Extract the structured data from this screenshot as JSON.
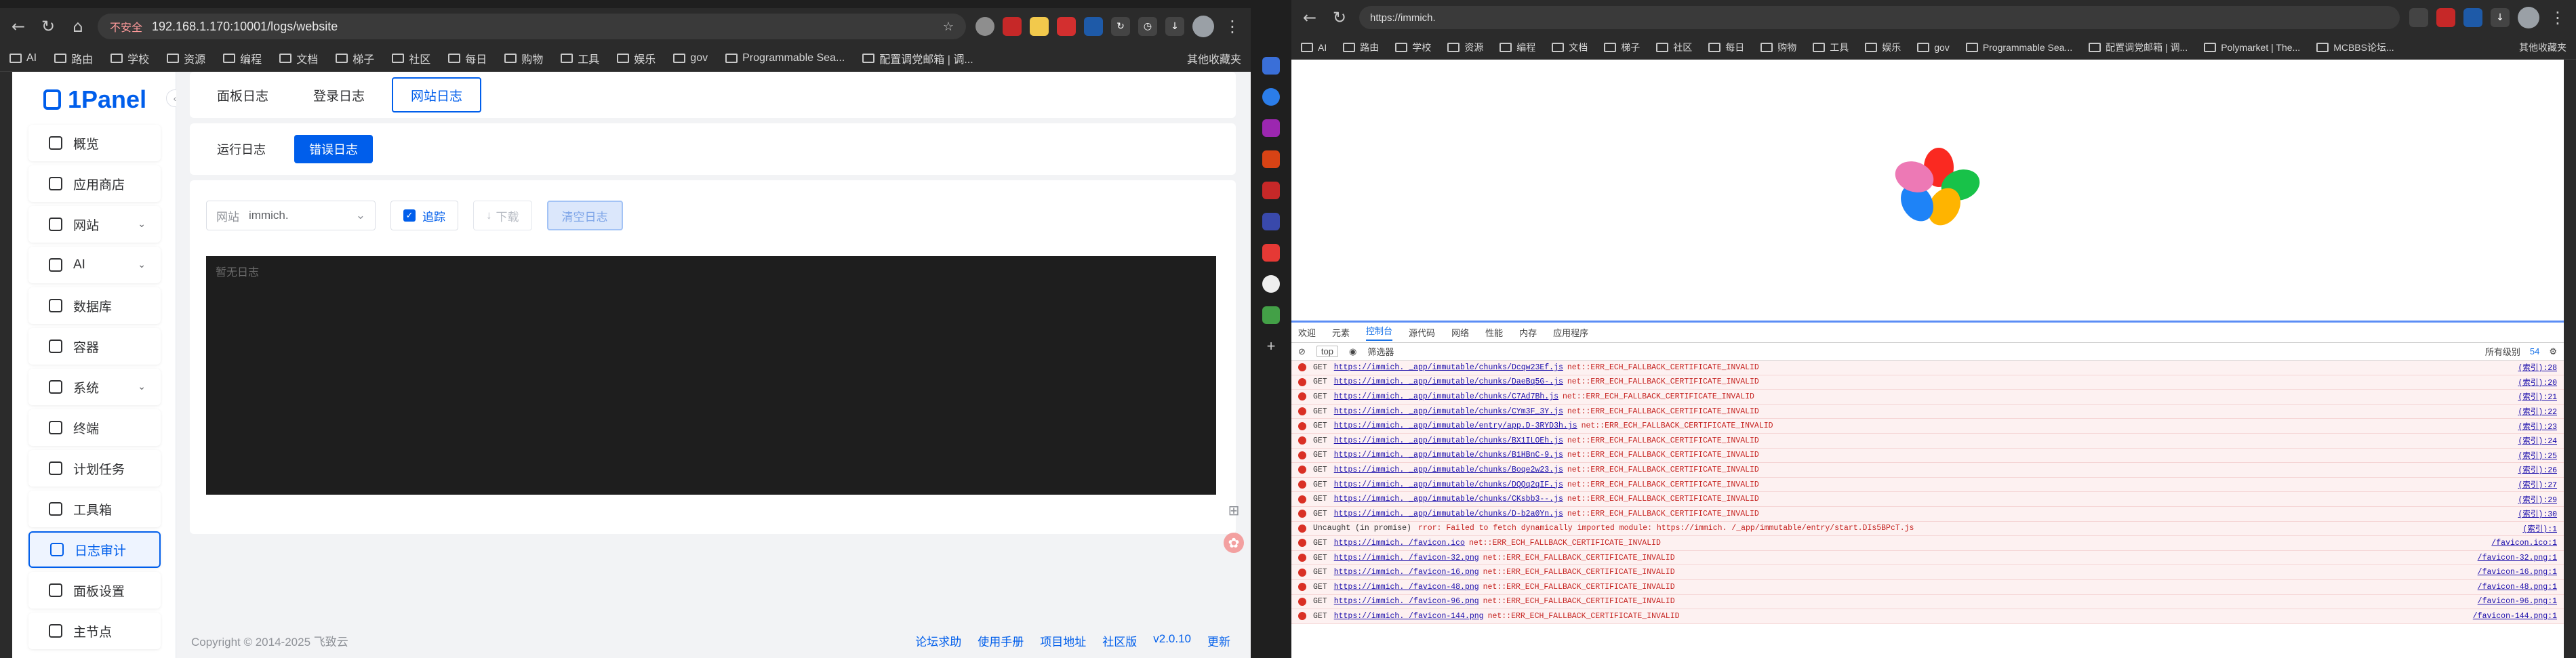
{
  "left_browser": {
    "url": "192.168.1.170:10001/logs/website",
    "security_label": "不安全",
    "bookmarks": [
      "AI",
      "路由",
      "学校",
      "资源",
      "编程",
      "文档",
      "梯子",
      "社区",
      "每日",
      "购物",
      "工具",
      "娱乐",
      "gov",
      "Programmable Sea...",
      "配置调党邮箱 | 调..."
    ],
    "bookmarks_other": "其他收藏夹"
  },
  "app": {
    "logo": "1Panel",
    "menu": [
      {
        "label": "概览",
        "chevron": false
      },
      {
        "label": "应用商店",
        "chevron": false
      },
      {
        "label": "网站",
        "chevron": true
      },
      {
        "label": "AI",
        "chevron": true
      },
      {
        "label": "数据库",
        "chevron": false
      },
      {
        "label": "容器",
        "chevron": false
      },
      {
        "label": "系统",
        "chevron": true
      },
      {
        "label": "终端",
        "chevron": false
      },
      {
        "label": "计划任务",
        "chevron": false
      },
      {
        "label": "工具箱",
        "chevron": false
      },
      {
        "label": "日志审计",
        "chevron": false,
        "active": true
      },
      {
        "label": "面板设置",
        "chevron": false
      },
      {
        "label": "主节点",
        "chevron": false
      }
    ],
    "tabs": [
      "面板日志",
      "登录日志",
      "网站日志"
    ],
    "active_tab": "网站日志",
    "subtabs": [
      "运行日志",
      "错误日志"
    ],
    "active_subtab": "错误日志",
    "site_select": {
      "prefix": "网站",
      "value": "immich."
    },
    "follow_label": "追踪",
    "download_label": "下载",
    "clear_label": "清空日志",
    "empty_log": "暂无日志",
    "footer_copyright": "Copyright © 2014-2025 飞致云",
    "footer_links": [
      "论坛求助",
      "使用手册",
      "项目地址",
      "社区版"
    ],
    "version": "v2.0.10",
    "update_label": "更新"
  },
  "right_browser": {
    "url": "https://immich.",
    "bookmarks": [
      "AI",
      "路由",
      "学校",
      "资源",
      "编程",
      "文档",
      "梯子",
      "社区",
      "每日",
      "购物",
      "工具",
      "娱乐",
      "gov",
      "Programmable Sea...",
      "配置调党邮箱 | 调...",
      "Polymarket | The...",
      "MCBBS论坛..."
    ],
    "bookmarks_other": "其他收藏夹"
  },
  "devtools": {
    "tabs": [
      "欢迎",
      "元素",
      "控制台",
      "源代码",
      "网络",
      "性能",
      "内存",
      "应用程序"
    ],
    "active_tab": "控制台",
    "context": "top",
    "filter_placeholder": "筛选器",
    "level": "所有级别",
    "issues": "54",
    "logs": [
      {
        "m": "GET",
        "u": "https://immich.",
        "p": "_app/immutable/chunks/Dcqw23Ef.js",
        "msg": "net::ERR_ECH_FALLBACK_CERTIFICATE_INVALID",
        "src": "(索引):28"
      },
      {
        "m": "GET",
        "u": "https://immich.",
        "p": "_app/immutable/chunks/DaeBq5G-.js",
        "msg": "net::ERR_ECH_FALLBACK_CERTIFICATE_INVALID",
        "src": "(索引):20"
      },
      {
        "m": "GET",
        "u": "https://immich.",
        "p": "_app/immutable/chunks/C7Ad7Bh.js",
        "msg": "net::ERR_ECH_FALLBACK_CERTIFICATE_INVALID",
        "src": "(索引):21"
      },
      {
        "m": "GET",
        "u": "https://immich.",
        "p": "_app/immutable/chunks/CYm3F_3Y.js",
        "msg": "net::ERR_ECH_FALLBACK_CERTIFICATE_INVALID",
        "src": "(索引):22"
      },
      {
        "m": "GET",
        "u": "https://immich.",
        "p": "_app/immutable/entry/app.D-3RYD3h.js",
        "msg": "net::ERR_ECH_FALLBACK_CERTIFICATE_INVALID",
        "src": "(索引):23"
      },
      {
        "m": "GET",
        "u": "https://immich.",
        "p": "_app/immutable/chunks/BX1ILOEh.js",
        "msg": "net::ERR_ECH_FALLBACK_CERTIFICATE_INVALID",
        "src": "(索引):24"
      },
      {
        "m": "GET",
        "u": "https://immich.",
        "p": "_app/immutable/chunks/B1HBnC-9.js",
        "msg": "net::ERR_ECH_FALLBACK_CERTIFICATE_INVALID",
        "src": "(索引):25"
      },
      {
        "m": "GET",
        "u": "https://immich.",
        "p": "_app/immutable/chunks/Boqe2w23.js",
        "msg": "net::ERR_ECH_FALLBACK_CERTIFICATE_INVALID",
        "src": "(索引):26"
      },
      {
        "m": "GET",
        "u": "https://immich.",
        "p": "_app/immutable/chunks/DQQq2qIF.js",
        "msg": "net::ERR_ECH_FALLBACK_CERTIFICATE_INVALID",
        "src": "(索引):27"
      },
      {
        "m": "GET",
        "u": "https://immich.",
        "p": "_app/immutable/chunks/CKsbb3--.js",
        "msg": "net::ERR_ECH_FALLBACK_CERTIFICATE_INVALID",
        "src": "(索引):29"
      },
      {
        "m": "GET",
        "u": "https://immich.",
        "p": "_app/immutable/chunks/D-b2a0Yn.js",
        "msg": "net::ERR_ECH_FALLBACK_CERTIFICATE_INVALID",
        "src": "(索引):30"
      },
      {
        "m": "Uncaught (in promise)",
        "u": "",
        "p": "",
        "msg": "rror: Failed to fetch dynamically imported module: https://immich.     /_app/immutable/entry/start.DIs5BPcT.js",
        "src": "(索引):1"
      },
      {
        "m": "GET",
        "u": "https://immich.",
        "p": "/favicon.ico",
        "msg": "net::ERR_ECH_FALLBACK_CERTIFICATE_INVALID",
        "src": "/favicon.ico:1"
      },
      {
        "m": "GET",
        "u": "https://immich.",
        "p": "/favicon-32.png",
        "msg": "net::ERR_ECH_FALLBACK_CERTIFICATE_INVALID",
        "src": "/favicon-32.png:1"
      },
      {
        "m": "GET",
        "u": "https://immich.",
        "p": "/favicon-16.png",
        "msg": "net::ERR_ECH_FALLBACK_CERTIFICATE_INVALID",
        "src": "/favicon-16.png:1"
      },
      {
        "m": "GET",
        "u": "https://immich.",
        "p": "/favicon-48.png",
        "msg": "net::ERR_ECH_FALLBACK_CERTIFICATE_INVALID",
        "src": "/favicon-48.png:1"
      },
      {
        "m": "GET",
        "u": "https://immich.",
        "p": "/favicon-96.png",
        "msg": "net::ERR_ECH_FALLBACK_CERTIFICATE_INVALID",
        "src": "/favicon-96.png:1"
      },
      {
        "m": "GET",
        "u": "https://immich.",
        "p": "/favicon-144.png",
        "msg": "net::ERR_ECH_FALLBACK_CERTIFICATE_INVALID",
        "src": "/favicon-144.png:1"
      }
    ]
  },
  "colors": {
    "brand": "#005eeb",
    "console_bg": "#1e1e1e",
    "error_row": "#fdf1f1",
    "error_text": "#c5221f"
  }
}
